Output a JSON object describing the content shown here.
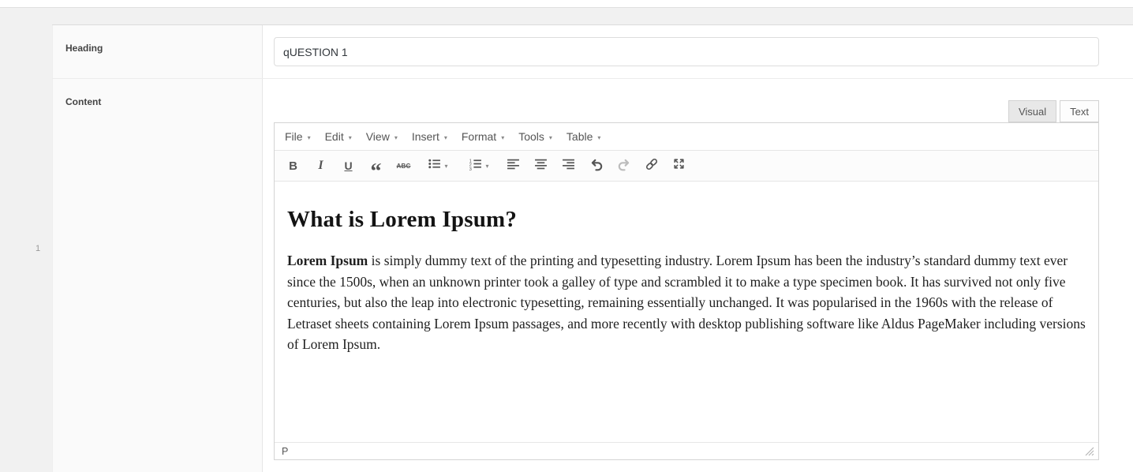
{
  "form": {
    "row_number": "1",
    "fields": [
      {
        "label": "Heading"
      },
      {
        "label": "Content"
      }
    ],
    "heading_value": "qUESTION 1"
  },
  "editor": {
    "tabs": {
      "visual": "Visual",
      "text": "Text"
    },
    "menus": [
      "File",
      "Edit",
      "View",
      "Insert",
      "Format",
      "Tools",
      "Table"
    ],
    "chevron": "▾",
    "toolbar": {
      "bold": "B",
      "italic": "I",
      "underline": "U",
      "blockquote": "“",
      "strikethrough": "ABC"
    },
    "content": {
      "title": "What is Lorem Ipsum?",
      "lead_bold": "Lorem Ipsum",
      "body": " is simply dummy text of the printing and typesetting industry. Lorem Ipsum has been the industry’s standard dummy text ever since the 1500s, when an unknown printer took a galley of type and scrambled it to make a type specimen book. It has survived not only five centuries, but also the leap into electronic typesetting, remaining essentially unchanged. It was popularised in the 1960s with the release of Letraset sheets containing Lorem Ipsum passages, and more recently with desktop publishing software like Aldus PageMaker including versions of Lorem Ipsum."
    },
    "statusbar": {
      "path": "P"
    }
  },
  "colors": {
    "page_background": "#f1f1f1",
    "toolbar_icon": "#555555",
    "border": "#dddddd"
  }
}
